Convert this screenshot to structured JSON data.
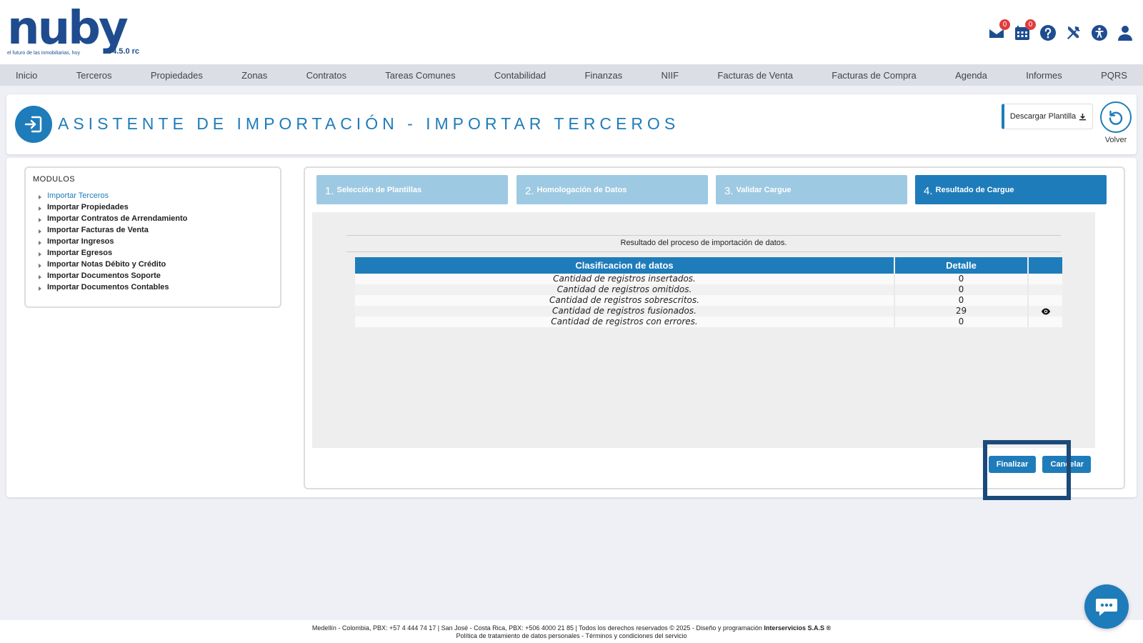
{
  "brand": {
    "logo_word": "nuby",
    "tagline": "el futuro de las inmobiliarias, hoy",
    "version": "v4.5.0 rc"
  },
  "header": {
    "icons": [
      {
        "name": "mail-icon",
        "badge": "0"
      },
      {
        "name": "calendar-icon",
        "badge": "0"
      },
      {
        "name": "help-icon"
      },
      {
        "name": "tools-icon"
      },
      {
        "name": "accessibility-icon"
      },
      {
        "name": "user-icon"
      }
    ]
  },
  "nav": [
    "Inicio",
    "Terceros",
    "Propiedades",
    "Zonas",
    "Contratos",
    "Tareas Comunes",
    "Contabilidad",
    "Finanzas",
    "NIIF",
    "Facturas de Venta",
    "Facturas de Compra",
    "Agenda",
    "Informes",
    "PQRS"
  ],
  "title": {
    "text": "ASISTENTE DE IMPORTACIÓN - IMPORTAR TERCEROS",
    "download_label": "Descargar Plantilla",
    "back_label": "Volver"
  },
  "modules": {
    "heading": "MODULOS",
    "items": [
      "Importar Terceros",
      "Importar Propiedades",
      "Importar Contratos de Arrendamiento",
      "Importar Facturas de Venta",
      "Importar Ingresos",
      "Importar Egresos",
      "Importar Notas Débito y Crédito",
      "Importar Documentos Soporte",
      "Importar Documentos Contables"
    ],
    "active_index": 0
  },
  "steps": [
    {
      "num": "1.",
      "label": "Selección de Plantillas"
    },
    {
      "num": "2.",
      "label": "Homologación de Datos"
    },
    {
      "num": "3.",
      "label": "Validar Cargue"
    },
    {
      "num": "4.",
      "label": "Resultado de Cargue"
    }
  ],
  "active_step": 3,
  "result": {
    "message": "Resultado del proceso de importación de datos.",
    "headers": {
      "classification": "Clasificacion de datos",
      "detail": "Detalle"
    },
    "rows": [
      {
        "label": "Cantidad de registros insertados.",
        "value": "0"
      },
      {
        "label": "Cantidad de registros omitidos.",
        "value": "0"
      },
      {
        "label": "Cantidad de registros sobrescritos.",
        "value": "0"
      },
      {
        "label": "Cantidad de registros fusionados.",
        "value": "29",
        "has_view": true
      },
      {
        "label": "Cantidad de registros con errores.",
        "value": "0"
      }
    ]
  },
  "actions": {
    "finish": "Finalizar",
    "cancel": "Cancelar"
  },
  "footer": {
    "line1": "Medellín - Colombia, PBX: +57 4 444 74 17 | San José - Costa Rica, PBX: +506 4000 21 85 | Todos los derechos reservados © 2025 - Diseño y programación ",
    "company": "Interservicios S.A.S ®",
    "line2": "Política de tratamiento de datos personales - Términos y condiciones del servicio"
  },
  "colors": {
    "primary": "#1f7cba",
    "brand": "#1e4c8f",
    "step_inactive": "#9ec9e2",
    "highlight": "#1b4a7a"
  }
}
